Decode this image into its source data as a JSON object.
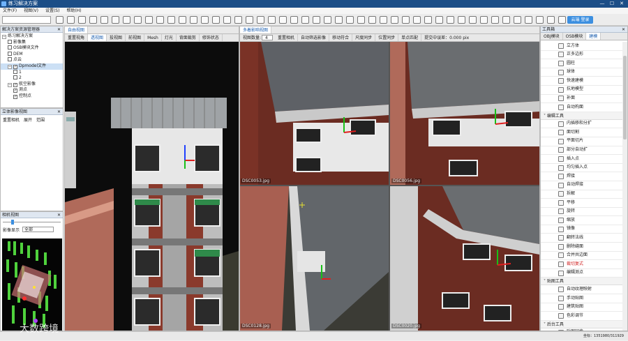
{
  "window": {
    "title": "练习解决方案",
    "minimize": "—",
    "maximize": "☐",
    "close": "✕"
  },
  "menu": [
    "文件(F)",
    "视图(V)",
    "设置(S)",
    "帮助(H)"
  ],
  "toolbar": {
    "login_label": "云端 登录"
  },
  "solution_panel": {
    "title": "解决方案资源管理器",
    "items": [
      {
        "label": "练习解决方案",
        "level": 0,
        "fold": "−"
      },
      {
        "label": "影像集",
        "level": 1,
        "check": false
      },
      {
        "label": "OSB模块文件",
        "level": 1,
        "check": false
      },
      {
        "label": "DEM",
        "level": 1,
        "check": false
      },
      {
        "label": "点云",
        "level": 1,
        "check": false
      },
      {
        "label": "Dpmodel文件",
        "level": 1,
        "check": true,
        "selected": true,
        "fold": "−"
      },
      {
        "label": "1",
        "level": 2,
        "check": false
      },
      {
        "label": "2",
        "level": 2,
        "check": false
      },
      {
        "label": "航空影像",
        "level": 1,
        "check": true,
        "fold": "−"
      },
      {
        "label": "测点",
        "level": 2,
        "check": true
      },
      {
        "label": "控制点",
        "level": 2,
        "check": true
      }
    ]
  },
  "stereo_panel": {
    "title": "立体影像视图",
    "buttons": [
      "重置相机",
      "展开",
      "范围"
    ]
  },
  "camera_panel": {
    "title": "相机视图",
    "filter_label": "影像显示",
    "filter_value": "全部"
  },
  "free_view": {
    "tab": "自由视图",
    "buttons": [
      "重置视角",
      "透视图",
      "投视图",
      "前视图",
      "Mesh",
      "灯光",
      "背面裁剪",
      "修饰状态"
    ],
    "active": "透视图"
  },
  "multi_view": {
    "tab": "多着影响视图",
    "count_label": "视图数量:",
    "count_value": "4",
    "buttons": [
      "重置相机",
      "自动筛选影像",
      "移动符合",
      "尺度同步",
      "位置同步",
      "单点匹配"
    ],
    "precision_label": "提交中误差：0.000 pix",
    "images": [
      "DSC0053.jpg",
      "DSC0056.jpg",
      "DSC0128.jpg",
      "DSC0020.jpg"
    ]
  },
  "tools_panel": {
    "title": "工具箱",
    "tabs": [
      "OBJ模块",
      "OSB模块",
      "建模"
    ],
    "active_tab": "建模",
    "groups": [
      {
        "name": null,
        "items": [
          "立方体",
          "正多边形",
          "圆柱",
          "球体",
          "快速建模",
          "抗地模型",
          "补面",
          "自动构面"
        ]
      },
      {
        "name": "编辑工具",
        "items": [
          "内插移和分扩",
          "面切割",
          "平面切片",
          "部分自动扩",
          "插入点",
          "均匀插入点",
          "焊接",
          "自动焊接",
          "拆解",
          "平移",
          "旋转",
          "缩放",
          "镜像",
          "翻转法线",
          "删除缝面",
          "合并共边面",
          "裁切复式",
          "编辑测点"
        ]
      },
      {
        "name": "贴图工具",
        "items": [
          "自动纹理映射",
          "手动贴图",
          "建筑贴图",
          "色彩调节"
        ]
      },
      {
        "name": "后台工具",
        "items": [
          "贴图同步"
        ]
      }
    ],
    "highlight_item": "裁切复式"
  },
  "status": {
    "right": "坐标：1351980/311929",
    "watermark": "大数跨境"
  },
  "colors": {
    "title_bar": "#1c4e87",
    "accent": "#3c8fe0",
    "axis_x": "#e02020",
    "axis_y": "#18c018",
    "axis_z": "#2040ff"
  }
}
